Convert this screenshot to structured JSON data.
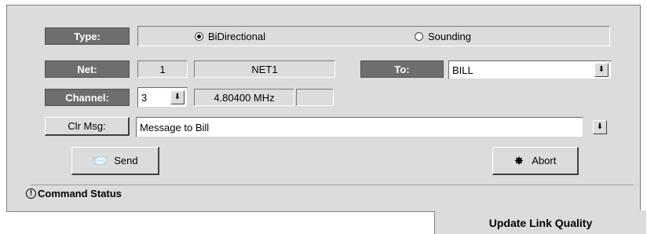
{
  "type_row": {
    "label": "Type:",
    "options": [
      {
        "label": "BiDirectional",
        "selected": true
      },
      {
        "label": "Sounding",
        "selected": false
      }
    ]
  },
  "net_row": {
    "label": "Net:",
    "net_number": "1",
    "net_name": "NET1",
    "to_label": "To:",
    "to_value": "BILL"
  },
  "channel_row": {
    "label": "Channel:",
    "channel_value": "3",
    "frequency": "4.80400 MHz",
    "extra": ""
  },
  "message_row": {
    "clr_label": "Clr Msg:",
    "message": "Message to Bill"
  },
  "buttons": {
    "send": "Send",
    "abort": "Abort"
  },
  "status": {
    "label": "Command Status"
  },
  "tab": {
    "label": "Update Link Quality"
  },
  "icons": {
    "dropdown": "down-arrow-icon",
    "send": "send-icon",
    "abort": "abort-icon",
    "status": "exclamation-icon"
  }
}
